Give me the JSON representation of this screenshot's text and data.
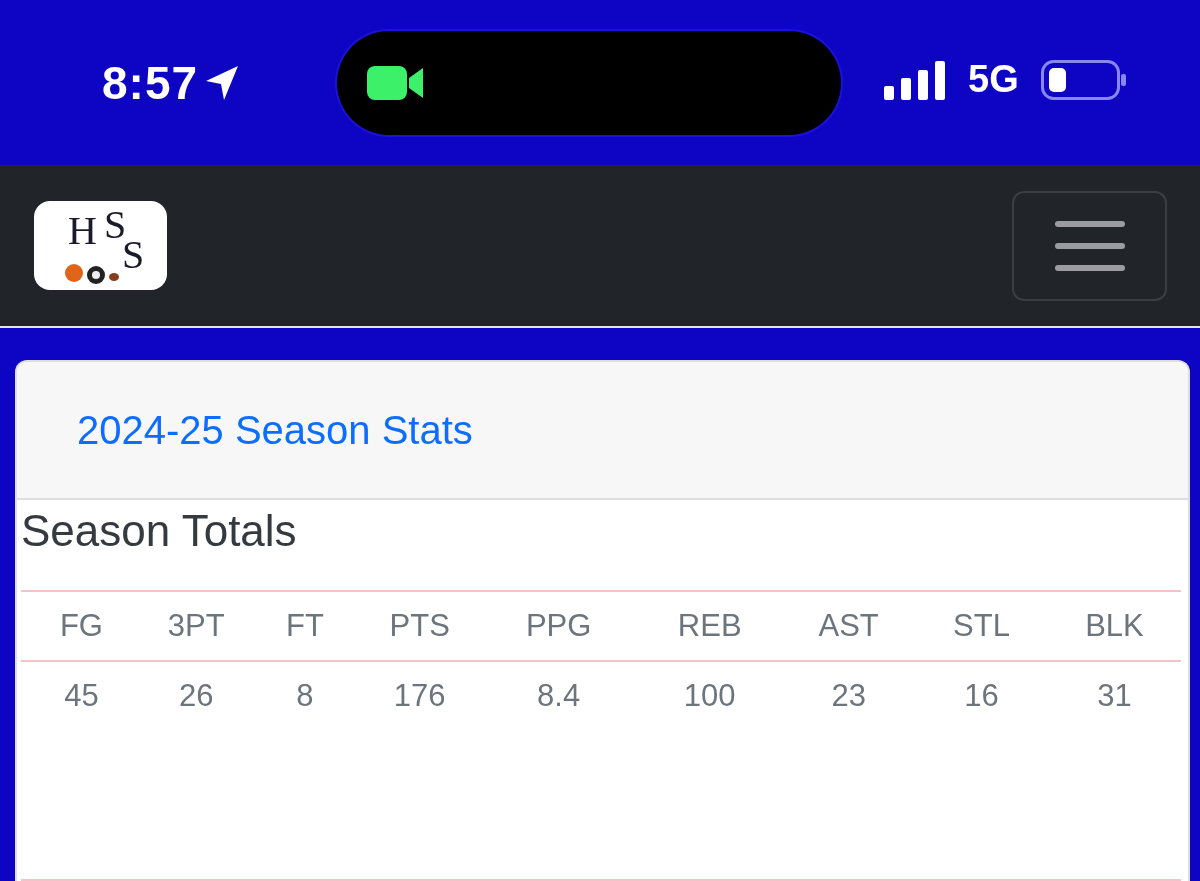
{
  "status_bar": {
    "time": "8:57",
    "network": "5G"
  },
  "navbar": {
    "logo_letters": [
      "H",
      "S",
      "S"
    ]
  },
  "card": {
    "title": "2024-25 Season Stats",
    "section_title": "Season Totals",
    "table": {
      "columns": [
        "FG",
        "3PT",
        "FT",
        "PTS",
        "PPG",
        "REB",
        "AST",
        "STL",
        "BLK"
      ],
      "rows": [
        [
          "45",
          "26",
          "8",
          "176",
          "8.4",
          "100",
          "23",
          "16",
          "31"
        ]
      ]
    }
  }
}
